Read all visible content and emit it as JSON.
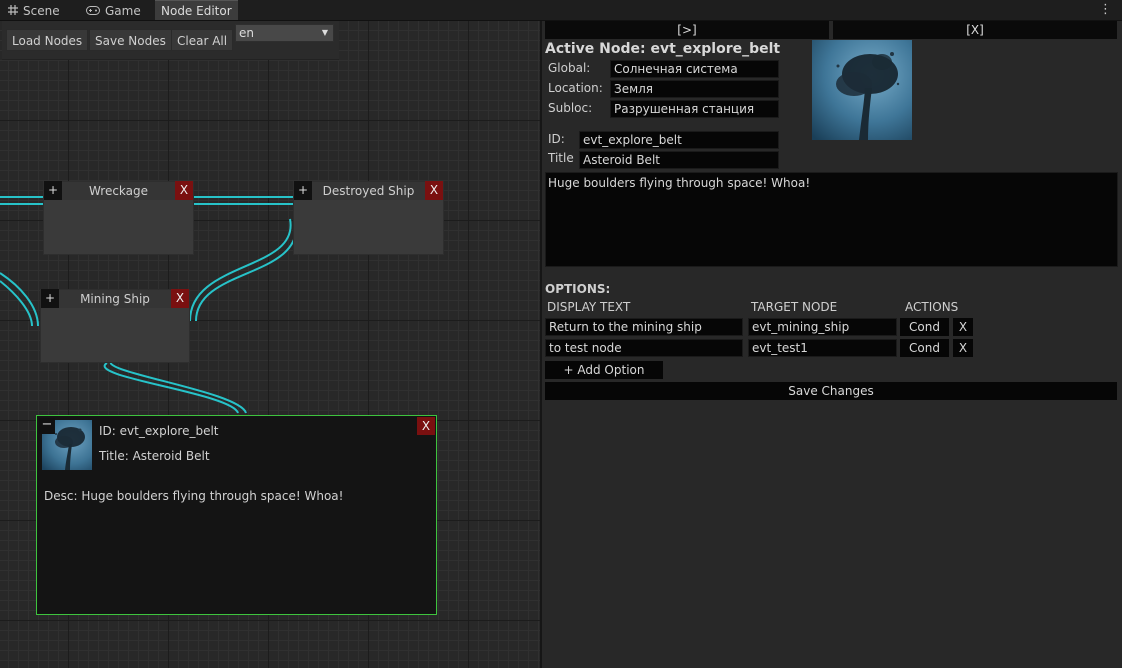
{
  "tabs": [
    {
      "label": "Scene",
      "icon": "grid-icon"
    },
    {
      "label": "Game",
      "icon": "gamepad-icon"
    },
    {
      "label": "Node Editor",
      "icon": ""
    }
  ],
  "menu_icon": "⋮",
  "toolbar": {
    "load_label": "Load Nodes",
    "save_label": "Save Nodes",
    "clear_label": "Clear All",
    "language_value": "en"
  },
  "nodes": [
    {
      "title": "Wreckage",
      "plus": "+",
      "close": "X"
    },
    {
      "title": "Destroyed Ship",
      "plus": "+",
      "close": "X"
    },
    {
      "title": "Mining Ship",
      "plus": "+",
      "close": "X"
    }
  ],
  "active_node_card": {
    "collapse": "−",
    "close": "X",
    "id_line": "ID: evt_explore_belt",
    "title_line": "Title: Asteroid Belt",
    "desc_line": "Desc: Huge boulders flying through space! Whoa!"
  },
  "panel": {
    "expand_button": "[>]",
    "close_button": "[X]",
    "heading": "Active Node: evt_explore_belt",
    "global_label": "Global:",
    "global_value": "Солнечная система",
    "location_label": "Location:",
    "location_value": "Земля",
    "subloc_label": "Subloc:",
    "subloc_value": "Разрушенная станция",
    "id_label": "ID:",
    "id_value": "evt_explore_belt",
    "title_label": "Title",
    "title_value": "Asteroid Belt",
    "description": "Huge boulders flying through space! Whoa!",
    "options_heading": "OPTIONS:",
    "col_display": "DISPLAY TEXT",
    "col_target": "TARGET NODE",
    "col_actions": "ACTIONS",
    "options": [
      {
        "text": "Return to the mining ship",
        "target": "evt_mining_ship",
        "cond": "Cond",
        "remove": "X"
      },
      {
        "text": "to test node",
        "target": "evt_test1",
        "cond": "Cond",
        "remove": "X"
      }
    ],
    "add_option": "+ Add Option",
    "save_changes": "Save Changes"
  },
  "colors": {
    "link": "#27c3c9",
    "selected_border": "#3ec43e",
    "close_red": "#7a1010"
  }
}
